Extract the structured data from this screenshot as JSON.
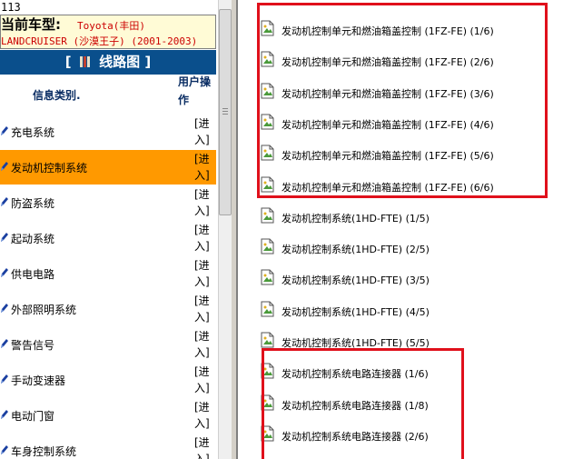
{
  "left": {
    "code": "113",
    "vehicle": {
      "label": "当前车型:",
      "make": "Toyota(丰田)",
      "model": "LANDCRUISER (沙漠王子) (2001-2003)"
    },
    "title": "线路图",
    "header": {
      "category": "信息类别.",
      "operation": "用户操作"
    },
    "enter_label": "[进入]",
    "categories": [
      {
        "name": "充电系统",
        "selected": false
      },
      {
        "name": "发动机控制系统",
        "selected": true
      },
      {
        "name": "防盗系统",
        "selected": false
      },
      {
        "name": "起动系统",
        "selected": false
      },
      {
        "name": "供电电路",
        "selected": false
      },
      {
        "name": "外部照明系统",
        "selected": false
      },
      {
        "name": "警告信号",
        "selected": false
      },
      {
        "name": "手动变速器",
        "selected": false
      },
      {
        "name": "电动门窗",
        "selected": false
      },
      {
        "name": "车身控制系统",
        "selected": false
      }
    ],
    "selected_color": "#ff9900",
    "title_bg": "#0a4f8c"
  },
  "right": {
    "items": [
      "发动机控制单元和燃油箱盖控制 (1FZ-FE) (1/6)",
      "发动机控制单元和燃油箱盖控制 (1FZ-FE) (2/6)",
      "发动机控制单元和燃油箱盖控制 (1FZ-FE) (3/6)",
      "发动机控制单元和燃油箱盖控制 (1FZ-FE) (4/6)",
      "发动机控制单元和燃油箱盖控制 (1FZ-FE) (5/6)",
      "发动机控制单元和燃油箱盖控制 (1FZ-FE) (6/6)",
      "发动机控制系统(1HD-FTE) (1/5)",
      "发动机控制系统(1HD-FTE) (2/5)",
      "发动机控制系统(1HD-FTE) (3/5)",
      "发动机控制系统(1HD-FTE) (4/5)",
      "发动机控制系统(1HD-FTE) (5/5)",
      "发动机控制系统电路连接器 (1/6)",
      "发动机控制系统电路连接器 (1/8)",
      "发动机控制系统电路连接器 (2/6)"
    ],
    "highlight_color": "#e0101b"
  }
}
